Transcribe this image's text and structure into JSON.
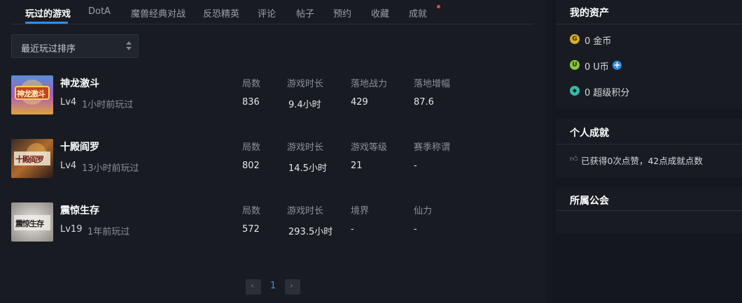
{
  "tabs": [
    {
      "label": "玩过的游戏",
      "active": true
    },
    {
      "label": "DotA"
    },
    {
      "label": "魔兽经典对战"
    },
    {
      "label": "反恐精英"
    },
    {
      "label": "评论"
    },
    {
      "label": "帖子"
    },
    {
      "label": "预约"
    },
    {
      "label": "收藏"
    },
    {
      "label": "成就",
      "has_notification_dot": true
    }
  ],
  "sort": {
    "selected": "最近玩过排序",
    "icon": "sort-arrows-icon"
  },
  "games": [
    {
      "name": "神龙激斗",
      "level": "Lv4",
      "last_played": "1小时前玩过",
      "cover_text": "神龙激斗",
      "stats": [
        {
          "label": "局数",
          "value": "836"
        },
        {
          "label": "游戏时长",
          "value": "9.4小时"
        },
        {
          "label": "落地战力",
          "value": "429"
        },
        {
          "label": "落地增幅",
          "value": "87.6"
        }
      ]
    },
    {
      "name": "十殿阎罗",
      "level": "Lv4",
      "last_played": "13小时前玩过",
      "cover_text": "十殿阎罗",
      "stats": [
        {
          "label": "局数",
          "value": "802"
        },
        {
          "label": "游戏时长",
          "value": "14.5小时"
        },
        {
          "label": "游戏等级",
          "value": "21"
        },
        {
          "label": "赛季称谓",
          "value": "-"
        }
      ]
    },
    {
      "name": "震惊生存",
      "level": "Lv19",
      "last_played": "1年前玩过",
      "cover_text": "震惊生存",
      "stats": [
        {
          "label": "局数",
          "value": "572"
        },
        {
          "label": "游戏时长",
          "value": "293.5小时"
        },
        {
          "label": "境界",
          "value": "-"
        },
        {
          "label": "仙力",
          "value": "-"
        }
      ]
    }
  ],
  "pagination": {
    "current": "1",
    "prev_icon": "chevron-left-icon",
    "next_icon": "chevron-right-icon"
  },
  "sidebar": {
    "assets": {
      "title": "我的资产",
      "items": [
        {
          "icon": "gold-coin-icon",
          "badge": "G",
          "text": "0 金币",
          "color": "#d4b028"
        },
        {
          "icon": "u-coin-icon",
          "badge": "U",
          "text": "0 U币",
          "color": "#8dc63f",
          "has_add": true
        },
        {
          "icon": "super-points-icon",
          "badge": "◆",
          "text": "0 超级积分",
          "color": "#3bb7a8"
        }
      ]
    },
    "achievements": {
      "title": "个人成就",
      "icon": "thumbs-up-icon",
      "text": "已获得0次点赞，42点成就点数"
    },
    "guild": {
      "title": "所属公会"
    }
  },
  "colors": {
    "accent": "#2f8ee8",
    "background": "#14171e",
    "panel": "#181b22",
    "notification": "#e5463b"
  }
}
